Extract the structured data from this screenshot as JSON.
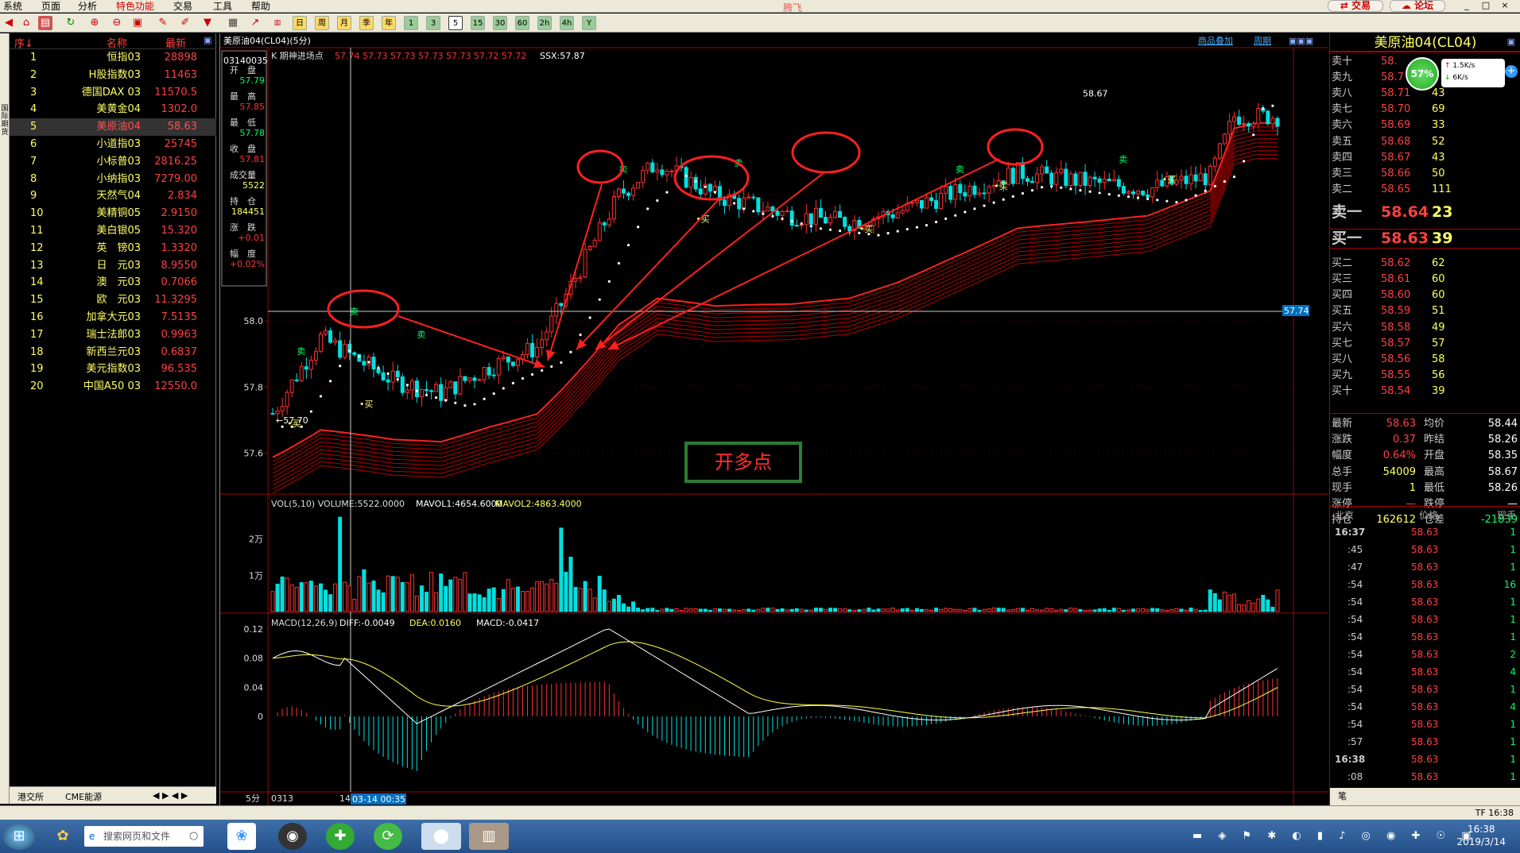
{
  "menubar": {
    "items": [
      "系统",
      "页面",
      "分析",
      "特色功能",
      "交易",
      "工具",
      "帮助"
    ],
    "app_title": "腾飞",
    "trade_btn": "交易",
    "forum_btn": "论坛"
  },
  "toolbar": {
    "periods": [
      "日",
      "周",
      "月",
      "季",
      "年",
      "1",
      "3",
      "5",
      "15",
      "30",
      "60",
      "2h",
      "4h",
      "Y"
    ]
  },
  "watchlist": {
    "headers": {
      "seq": "序↓",
      "name": "名称",
      "last": "最新"
    },
    "rows": [
      {
        "n": "1",
        "name": "恒指03",
        "last": "28898"
      },
      {
        "n": "2",
        "name": "H股指数03",
        "last": "11463"
      },
      {
        "n": "3",
        "name": "德国DAX 03",
        "last": "11570.5"
      },
      {
        "n": "4",
        "name": "美黄金04",
        "last": "1302.0"
      },
      {
        "n": "5",
        "name": "美原油04",
        "last": "58.63"
      },
      {
        "n": "6",
        "name": "小道指03",
        "last": "25745"
      },
      {
        "n": "7",
        "name": "小标普03",
        "last": "2816.25"
      },
      {
        "n": "8",
        "name": "小纳指03",
        "last": "7279.00"
      },
      {
        "n": "9",
        "name": "天然气04",
        "last": "2.834"
      },
      {
        "n": "10",
        "name": "美精铜05",
        "last": "2.9150"
      },
      {
        "n": "11",
        "name": "美白银05",
        "last": "15.320"
      },
      {
        "n": "12",
        "name": "英　镑03",
        "last": "1.3320"
      },
      {
        "n": "13",
        "name": "日　元03",
        "last": "8.9550"
      },
      {
        "n": "14",
        "name": "澳　元03",
        "last": "0.7066"
      },
      {
        "n": "15",
        "name": "欧　元03",
        "last": "11.3295"
      },
      {
        "n": "16",
        "name": "加拿大元03",
        "last": "7.5135"
      },
      {
        "n": "17",
        "name": "瑞士法郎03",
        "last": "0.9963"
      },
      {
        "n": "18",
        "name": "新西兰元03",
        "last": "0.6837"
      },
      {
        "n": "19",
        "name": "美元指数03",
        "last": "96.535"
      },
      {
        "n": "20",
        "name": "中国A50 03",
        "last": "12550.0"
      }
    ],
    "bottom_tabs": [
      "港交所",
      "CME能源"
    ]
  },
  "chart": {
    "title": "美原油04(CL04)(5分)",
    "top_links": [
      "商品叠加",
      "周期"
    ],
    "indicator_label": "K  期神进场点",
    "ma_values": "57.74  57.73  57.73  57.73  57.73  57.72  57.72",
    "ssx": "SSX:57.87",
    "info": {
      "code": "03140035",
      "open_label": "开　盘",
      "open": "57.79",
      "high_label": "最　高",
      "high": "57.85",
      "low_label": "最　低",
      "low": "57.78",
      "close_label": "收　盘",
      "close": "57.81",
      "vol_label": "成交量",
      "vol": "5522",
      "oi_label": "持　仓",
      "oi": "184451",
      "chg_label": "涨　跌",
      "chg": "+0.01",
      "pct_label": "幅　度",
      "pct": "+0.02%"
    },
    "price_ticks": [
      "58.0",
      "57.8",
      "57.6"
    ],
    "high_mark": "58.67",
    "low_mark": "57.70",
    "cursor_price": "57.74",
    "buy_tag": "买",
    "sell_tag": "卖",
    "callout": "开多点",
    "vol_header": "VOL(5,10)  VOLUME:5522.0000",
    "vol_ma1": "MAVOL1:4654.6000",
    "vol_ma2": "MAVOL2:4863.4000",
    "vol_ticks": [
      "2万",
      "1万"
    ],
    "macd_header": "MACD(12,26,9)",
    "macd_diff": "DIFF:-0.0049",
    "macd_dea": "DEA:0.0160",
    "macd_val": "MACD:-0.0417",
    "macd_ticks": [
      "0.12",
      "0.08",
      "0.04",
      "0"
    ],
    "xaxis": {
      "period": "5分",
      "d1": "0313",
      "d2": "14",
      "cursor": "03-14 00:35"
    }
  },
  "quote": {
    "title": "美原油04(CL04)",
    "gauge": "57%",
    "speed_up": "1.5K/s",
    "speed_down": "6K/s",
    "asks": [
      {
        "l": "卖十",
        "p": "58.",
        "v": ""
      },
      {
        "l": "卖九",
        "p": "58.7",
        "v": ""
      },
      {
        "l": "卖八",
        "p": "58.71",
        "v": "43"
      },
      {
        "l": "卖七",
        "p": "58.70",
        "v": "69"
      },
      {
        "l": "卖六",
        "p": "58.69",
        "v": "33"
      },
      {
        "l": "卖五",
        "p": "58.68",
        "v": "52"
      },
      {
        "l": "卖四",
        "p": "58.67",
        "v": "43"
      },
      {
        "l": "卖三",
        "p": "58.66",
        "v": "50"
      },
      {
        "l": "卖二",
        "p": "58.65",
        "v": "111"
      },
      {
        "l": "卖一",
        "p": "58.64",
        "v": "23"
      }
    ],
    "bids": [
      {
        "l": "买一",
        "p": "58.63",
        "v": "39"
      },
      {
        "l": "买二",
        "p": "58.62",
        "v": "62"
      },
      {
        "l": "买三",
        "p": "58.61",
        "v": "60"
      },
      {
        "l": "买四",
        "p": "58.60",
        "v": "60"
      },
      {
        "l": "买五",
        "p": "58.59",
        "v": "51"
      },
      {
        "l": "买六",
        "p": "58.58",
        "v": "49"
      },
      {
        "l": "买七",
        "p": "58.57",
        "v": "57"
      },
      {
        "l": "买八",
        "p": "58.56",
        "v": "58"
      },
      {
        "l": "买九",
        "p": "58.55",
        "v": "56"
      },
      {
        "l": "买十",
        "p": "58.54",
        "v": "39"
      }
    ],
    "stats": [
      {
        "a": "最新",
        "av": "58.63",
        "b": "均价",
        "bv": "58.44"
      },
      {
        "a": "涨跌",
        "av": "0.37",
        "b": "昨结",
        "bv": "58.26"
      },
      {
        "a": "幅度",
        "av": "0.64%",
        "b": "开盘",
        "bv": "58.35"
      },
      {
        "a": "总手",
        "av": "54009",
        "b": "最高",
        "bv": "58.67"
      },
      {
        "a": "现手",
        "av": "1",
        "b": "最低",
        "bv": "58.26"
      },
      {
        "a": "涨停",
        "av": "—",
        "b": "跌停",
        "bv": "—"
      },
      {
        "a": "持仓",
        "av": "162612",
        "b": "仓差",
        "bv": "-21839"
      }
    ],
    "ticks_header": {
      "a": "北京",
      "b": "价格",
      "c": "现手"
    },
    "ticks": [
      {
        "t": "16:37",
        "p": "58.63",
        "v": "1"
      },
      {
        "t": ":45",
        "p": "58.63",
        "v": "1"
      },
      {
        "t": ":47",
        "p": "58.63",
        "v": "1"
      },
      {
        "t": ":54",
        "p": "58.63",
        "v": "16"
      },
      {
        "t": ":54",
        "p": "58.63",
        "v": "1"
      },
      {
        "t": ":54",
        "p": "58.63",
        "v": "1"
      },
      {
        "t": ":54",
        "p": "58.63",
        "v": "1"
      },
      {
        "t": ":54",
        "p": "58.63",
        "v": "2"
      },
      {
        "t": ":54",
        "p": "58.63",
        "v": "4"
      },
      {
        "t": ":54",
        "p": "58.63",
        "v": "1"
      },
      {
        "t": ":54",
        "p": "58.63",
        "v": "4"
      },
      {
        "t": ":54",
        "p": "58.63",
        "v": "1"
      },
      {
        "t": ":57",
        "p": "58.63",
        "v": "1"
      },
      {
        "t": "16:38",
        "p": "58.63",
        "v": "1"
      },
      {
        "t": ":08",
        "p": "58.63",
        "v": "1"
      }
    ],
    "bottom_tab": "笔"
  },
  "statusbar": {
    "right": "TF  16:38"
  },
  "taskbar": {
    "search_placeholder": "搜索网页和文件",
    "time": "16:38",
    "date": "2019/3/14"
  }
}
